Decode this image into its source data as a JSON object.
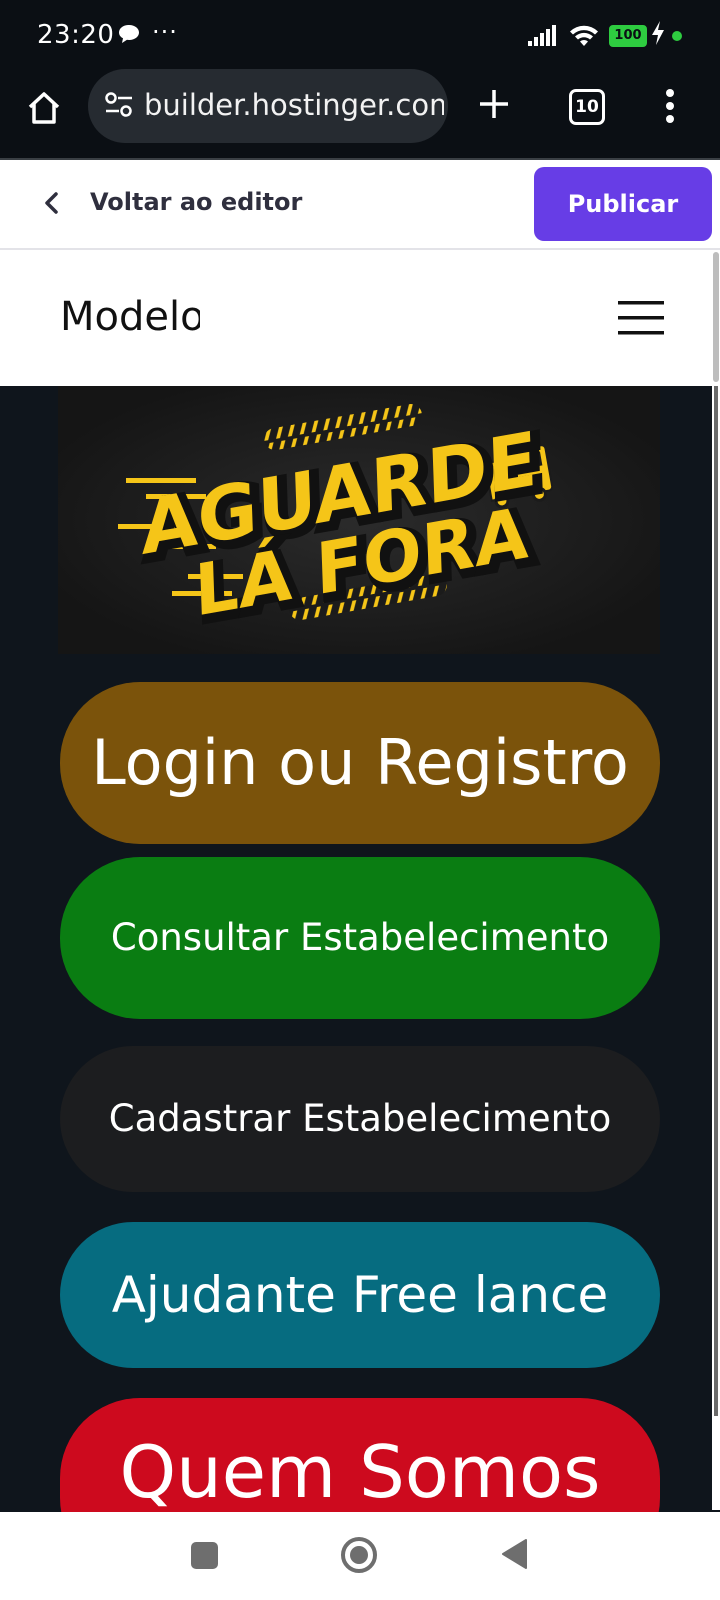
{
  "status_bar": {
    "time": "23:20",
    "more": "···",
    "battery": "100",
    "icons": [
      "chat-icon",
      "signal-icon",
      "wifi-icon",
      "battery-icon",
      "charging-icon"
    ]
  },
  "browser": {
    "url": "builder.hostinger.com",
    "tab_count": "10",
    "icons": [
      "home-icon",
      "site-settings-icon",
      "new-tab-icon",
      "tabs-icon",
      "menu-kebab-icon"
    ]
  },
  "editor": {
    "back_label": "Voltar ao editor",
    "publish_label": "Publicar",
    "accent": "#673de6"
  },
  "site": {
    "logo_text": "Modelo",
    "banner": {
      "line1": "AGUARDE",
      "line2": "LÁ FORA",
      "colors": {
        "text": "#f5c518",
        "background": "#1b1b1b"
      }
    },
    "buttons": [
      {
        "label": "Login ou Registro",
        "color": "#7b530b"
      },
      {
        "label": "Consultar Estabelecimento",
        "color": "#0a7d12"
      },
      {
        "label": "Cadastrar Estabelecimento",
        "color": "#1c1d1f"
      },
      {
        "label": "Ajudante Free lance",
        "color": "#066c80"
      },
      {
        "label": "Quem Somos",
        "color": "#cd0a1e"
      }
    ]
  },
  "nav_bar": {
    "icons": [
      "recents-square-icon",
      "home-circle-icon",
      "back-triangle-icon"
    ]
  }
}
